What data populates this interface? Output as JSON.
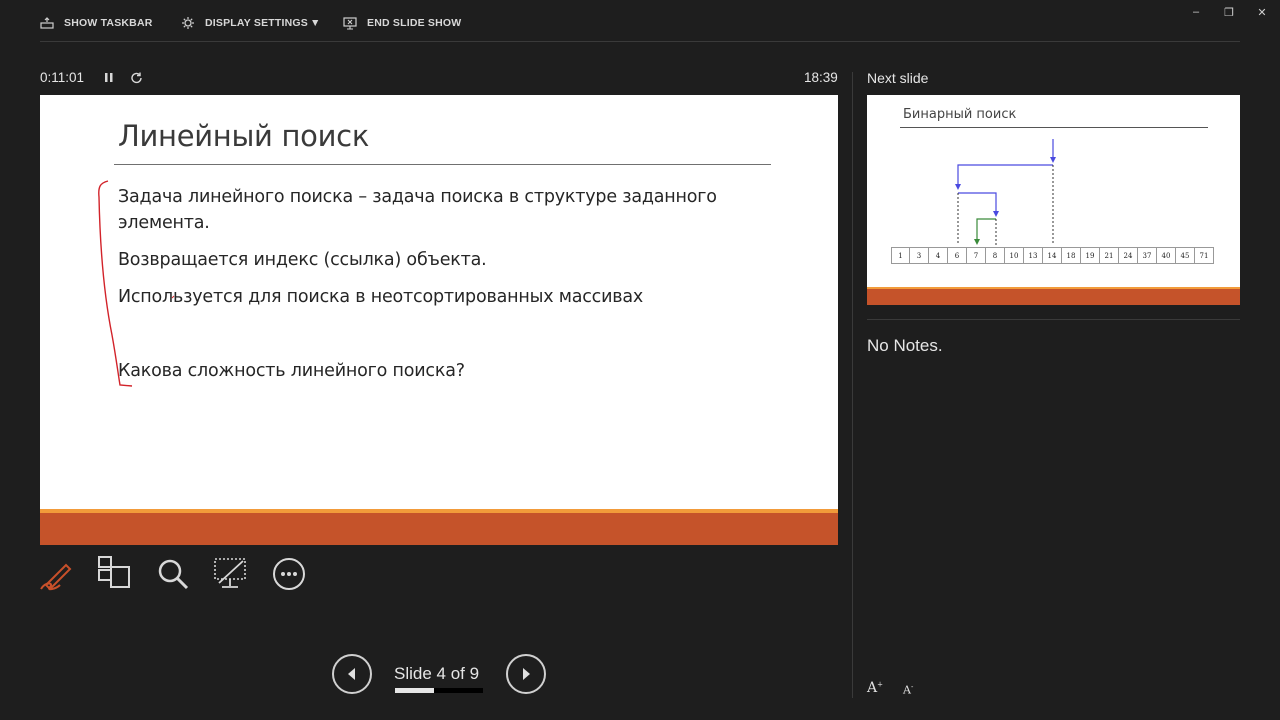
{
  "toolbar": {
    "show_taskbar": "SHOW TASKBAR",
    "display_settings": "DISPLAY SETTINGS",
    "display_settings_arrow": "▼",
    "end_slide_show": "END SLIDE SHOW"
  },
  "window_controls": {
    "minimize": "–",
    "restore": "❐",
    "close": "✕"
  },
  "timer": {
    "elapsed": "0:11:01",
    "clock": "18:39"
  },
  "slide": {
    "title": "Линейный поиск",
    "bullets": [
      "Задача линейного поиска – задача поиска в структуре заданного",
      "элемента.",
      "Возвращается индекс (ссылка) объекта.",
      "Используется для поиска в неотсортированных массивах",
      "Какова сложность линейного поиска?"
    ]
  },
  "next_slide": {
    "label": "Next slide",
    "thumb_title": "Бинарный поиск",
    "array_values": [
      "1",
      "3",
      "4",
      "6",
      "7",
      "8",
      "10",
      "13",
      "14",
      "18",
      "19",
      "21",
      "24",
      "37",
      "40",
      "45",
      "71"
    ]
  },
  "notes": {
    "text": "No Notes."
  },
  "navigation": {
    "slide_counter": "Slide 4 of 9",
    "progress": 0.444
  },
  "tools": [
    "pen-icon",
    "see-all-slides-icon",
    "zoom-icon",
    "black-screen-icon",
    "more-options-icon"
  ],
  "font_controls": {
    "increase": "A",
    "decrease": "A"
  },
  "colors": {
    "background": "#1e1e1e",
    "accent_orange": "#c5532a",
    "accent_light_orange": "#f29b3a",
    "ink_red": "#d2232a",
    "arrow_blue": "#4a4ae0",
    "arrow_green": "#3a8a3a"
  }
}
